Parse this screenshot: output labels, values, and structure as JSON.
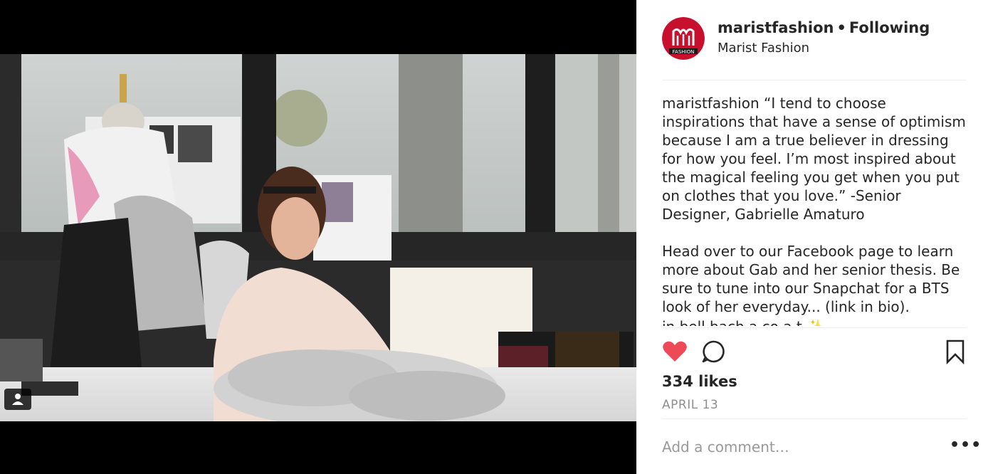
{
  "post": {
    "username": "maristfashion",
    "separator": "•",
    "follow_status": "Following",
    "subtitle": "Marist Fashion",
    "avatar_label": "FASHION",
    "caption_author": "maristfashion",
    "caption_lines": [
      "“I tend to choose",
      "inspirations that have a sense of optimism",
      "because I am a true believer in dressing",
      "for how you feel. I’m most inspired about",
      "the magical feeling you get when you put",
      "on clothes that you love.” -Senior",
      "Designer, Gabrielle Amaturo"
    ],
    "caption_lines_2": [
      "Head over to our Facebook page to learn",
      "more about Gab and her senior thesis. Be",
      "sure to tune into our Snapchat for a BTS",
      "look of her everyday... (link in bio)."
    ],
    "caption_cut_line": "in bell bach a co a t ✨",
    "likes": "334 likes",
    "date": "APRIL 13",
    "comment_placeholder": "Add a comment…",
    "more_label": "•••"
  },
  "icons": {
    "like": "heart-icon",
    "comment": "comment-icon",
    "save": "bookmark-icon",
    "tag": "user-tag-icon"
  },
  "colors": {
    "like_red": "#ed4956",
    "brand_red": "#c8102e",
    "muted": "#8e8e8e"
  }
}
